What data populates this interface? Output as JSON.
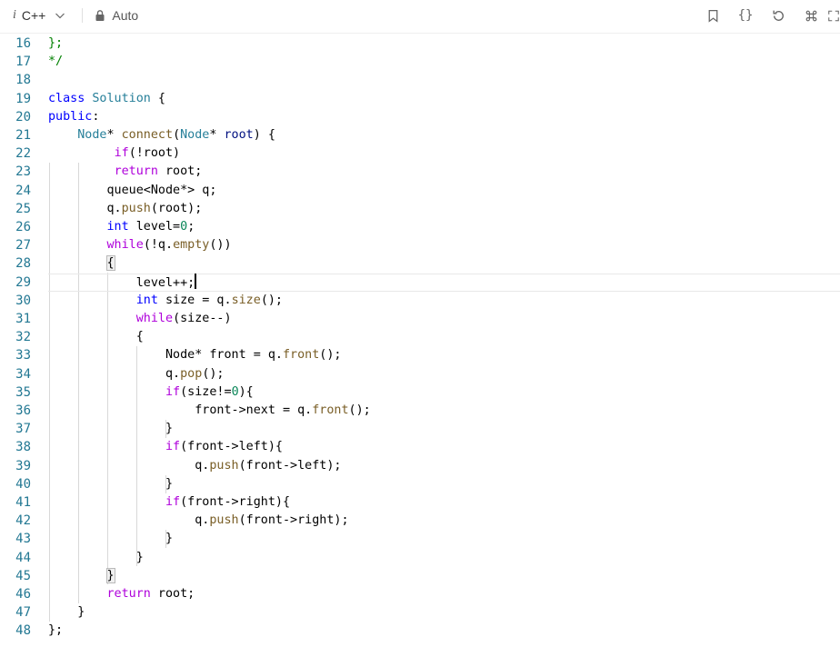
{
  "toolbar": {
    "lang_prefix": "i",
    "language": "C++",
    "mode": "Auto",
    "braces_label": "{}"
  },
  "editor": {
    "current_line": 29,
    "lines": [
      {
        "n": "16",
        "tokens": [
          [
            "cm",
            "};"
          ]
        ]
      },
      {
        "n": "17",
        "tokens": [
          [
            "cm",
            "*/"
          ]
        ]
      },
      {
        "n": "18",
        "tokens": []
      },
      {
        "n": "19",
        "tokens": [
          [
            "kw",
            "class"
          ],
          [
            "pl",
            " "
          ],
          [
            "type",
            "Solution"
          ],
          [
            "pl",
            " {"
          ]
        ]
      },
      {
        "n": "20",
        "tokens": [
          [
            "kw",
            "public"
          ],
          [
            "pl",
            ":"
          ]
        ]
      },
      {
        "n": "21",
        "tokens": [
          [
            "pl",
            "    "
          ],
          [
            "type",
            "Node"
          ],
          [
            "pl",
            "* "
          ],
          [
            "fn",
            "connect"
          ],
          [
            "pl",
            "("
          ],
          [
            "type",
            "Node"
          ],
          [
            "pl",
            "* "
          ],
          [
            "var",
            "root"
          ],
          [
            "pl",
            ") {"
          ]
        ]
      },
      {
        "n": "22",
        "tokens": [
          [
            "pl",
            "         "
          ],
          [
            "ctrl",
            "if"
          ],
          [
            "pl",
            "(!root)"
          ]
        ]
      },
      {
        "n": "23",
        "tokens": [
          [
            "pl",
            "         "
          ],
          [
            "ctrl",
            "return"
          ],
          [
            "pl",
            " root;"
          ]
        ]
      },
      {
        "n": "24",
        "tokens": [
          [
            "pl",
            "        queue<Node*> q;"
          ]
        ]
      },
      {
        "n": "25",
        "tokens": [
          [
            "pl",
            "        q."
          ],
          [
            "fn",
            "push"
          ],
          [
            "pl",
            "(root);"
          ]
        ]
      },
      {
        "n": "26",
        "tokens": [
          [
            "pl",
            "        "
          ],
          [
            "kw",
            "int"
          ],
          [
            "pl",
            " level="
          ],
          [
            "num",
            "0"
          ],
          [
            "pl",
            ";"
          ]
        ]
      },
      {
        "n": "27",
        "tokens": [
          [
            "pl",
            "        "
          ],
          [
            "ctrl",
            "while"
          ],
          [
            "pl",
            "(!q."
          ],
          [
            "fn",
            "empty"
          ],
          [
            "pl",
            "())"
          ]
        ]
      },
      {
        "n": "28",
        "tokens": [
          [
            "pl",
            "        "
          ],
          [
            "br",
            "{"
          ]
        ]
      },
      {
        "n": "29",
        "tokens": [
          [
            "pl",
            "            level++;"
          ]
        ]
      },
      {
        "n": "30",
        "tokens": [
          [
            "pl",
            "            "
          ],
          [
            "kw",
            "int"
          ],
          [
            "pl",
            " size = q."
          ],
          [
            "fn",
            "size"
          ],
          [
            "pl",
            "();"
          ]
        ]
      },
      {
        "n": "31",
        "tokens": [
          [
            "pl",
            "            "
          ],
          [
            "ctrl",
            "while"
          ],
          [
            "pl",
            "(size--)"
          ]
        ]
      },
      {
        "n": "32",
        "tokens": [
          [
            "pl",
            "            {"
          ]
        ]
      },
      {
        "n": "33",
        "tokens": [
          [
            "pl",
            "                Node* front = q."
          ],
          [
            "fn",
            "front"
          ],
          [
            "pl",
            "();"
          ]
        ]
      },
      {
        "n": "34",
        "tokens": [
          [
            "pl",
            "                q."
          ],
          [
            "fn",
            "pop"
          ],
          [
            "pl",
            "();"
          ]
        ]
      },
      {
        "n": "35",
        "tokens": [
          [
            "pl",
            "                "
          ],
          [
            "ctrl",
            "if"
          ],
          [
            "pl",
            "(size!="
          ],
          [
            "num",
            "0"
          ],
          [
            "pl",
            "){"
          ]
        ]
      },
      {
        "n": "36",
        "tokens": [
          [
            "pl",
            "                    front->next = q."
          ],
          [
            "fn",
            "front"
          ],
          [
            "pl",
            "();"
          ]
        ]
      },
      {
        "n": "37",
        "tokens": [
          [
            "pl",
            "                }"
          ]
        ]
      },
      {
        "n": "38",
        "tokens": [
          [
            "pl",
            "                "
          ],
          [
            "ctrl",
            "if"
          ],
          [
            "pl",
            "(front->left){"
          ]
        ]
      },
      {
        "n": "39",
        "tokens": [
          [
            "pl",
            "                    q."
          ],
          [
            "fn",
            "push"
          ],
          [
            "pl",
            "(front->left);"
          ]
        ]
      },
      {
        "n": "40",
        "tokens": [
          [
            "pl",
            "                }"
          ]
        ]
      },
      {
        "n": "41",
        "tokens": [
          [
            "pl",
            "                "
          ],
          [
            "ctrl",
            "if"
          ],
          [
            "pl",
            "(front->right){"
          ]
        ]
      },
      {
        "n": "42",
        "tokens": [
          [
            "pl",
            "                    q."
          ],
          [
            "fn",
            "push"
          ],
          [
            "pl",
            "(front->right);"
          ]
        ]
      },
      {
        "n": "43",
        "tokens": [
          [
            "pl",
            "                }"
          ]
        ]
      },
      {
        "n": "44",
        "tokens": [
          [
            "pl",
            "            }"
          ]
        ]
      },
      {
        "n": "45",
        "tokens": [
          [
            "pl",
            "        "
          ],
          [
            "br",
            "}"
          ]
        ]
      },
      {
        "n": "46",
        "tokens": [
          [
            "pl",
            "        "
          ],
          [
            "ctrl",
            "return"
          ],
          [
            "pl",
            " root;"
          ]
        ]
      },
      {
        "n": "47",
        "tokens": [
          [
            "pl",
            "    }"
          ]
        ]
      },
      {
        "n": "48",
        "tokens": [
          [
            "pl",
            "};"
          ]
        ]
      }
    ]
  }
}
